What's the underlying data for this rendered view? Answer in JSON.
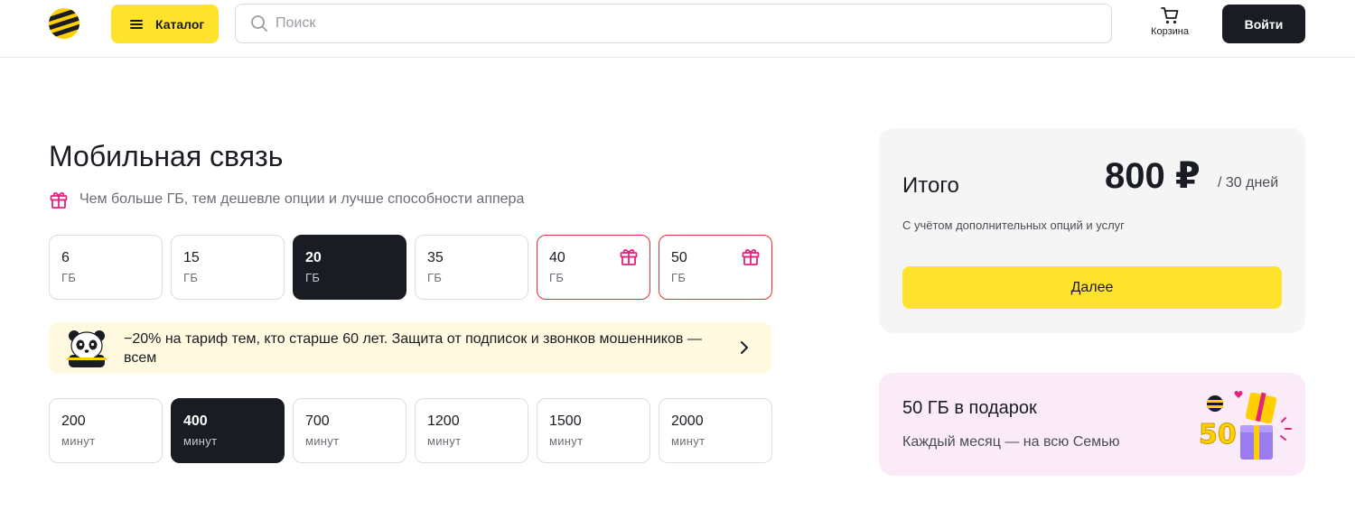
{
  "header": {
    "logo_icon": "beeline-logo-icon",
    "catalog_label": "Каталог",
    "search_placeholder": "Поиск",
    "cart_label": "Корзина",
    "login_label": "Войти"
  },
  "main": {
    "title": "Мобильная связь",
    "hint": "Чем больше ГБ, тем дешевле опции и лучше способности аппера",
    "gb_options": [
      {
        "value": "6",
        "unit": "ГБ",
        "selected": false,
        "gift": false
      },
      {
        "value": "15",
        "unit": "ГБ",
        "selected": false,
        "gift": false
      },
      {
        "value": "20",
        "unit": "ГБ",
        "selected": true,
        "gift": false
      },
      {
        "value": "35",
        "unit": "ГБ",
        "selected": false,
        "gift": false
      },
      {
        "value": "40",
        "unit": "ГБ",
        "selected": false,
        "gift": true
      },
      {
        "value": "50",
        "unit": "ГБ",
        "selected": false,
        "gift": true
      }
    ],
    "promo": "−20% на тариф тем, кто старше 60 лет. Защита от подписок и звонков мошенников — всем",
    "minute_options": [
      {
        "value": "200",
        "unit": "минут",
        "selected": false
      },
      {
        "value": "400",
        "unit": "минут",
        "selected": true
      },
      {
        "value": "700",
        "unit": "минут",
        "selected": false
      },
      {
        "value": "1200",
        "unit": "минут",
        "selected": false
      },
      {
        "value": "1500",
        "unit": "минут",
        "selected": false
      },
      {
        "value": "2000",
        "unit": "минут",
        "selected": false
      }
    ]
  },
  "summary": {
    "label": "Итого",
    "price": "800 ₽",
    "period": "/ 30 дней",
    "note": "С учётом дополнительных опций и услуг",
    "next_label": "Далее"
  },
  "gift_card": {
    "title": "50 ГБ в подарок",
    "subtitle": "Каждый месяц — на всю Семью",
    "art_text": "50"
  },
  "colors": {
    "accent_yellow": "#ffe22b",
    "dark": "#191c22",
    "gift_pink": "#e2237d",
    "gift_border": "#e0303a"
  }
}
